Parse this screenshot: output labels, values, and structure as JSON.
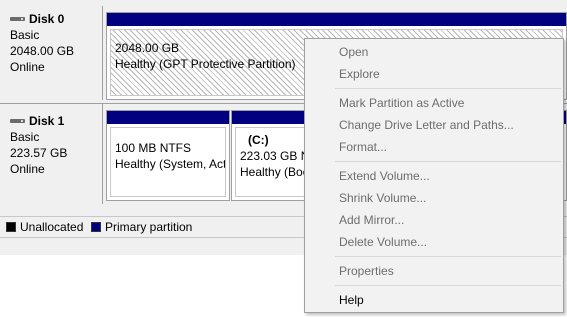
{
  "disks": [
    {
      "name": "Disk 0",
      "type": "Basic",
      "size": "2048.00 GB",
      "status": "Online",
      "partitions": [
        {
          "size": "2048.00 GB",
          "status": "Healthy (GPT Protective Partition)"
        }
      ]
    },
    {
      "name": "Disk 1",
      "type": "Basic",
      "size": "223.57 GB",
      "status": "Online",
      "partitions": [
        {
          "line1": "100 MB NTFS",
          "status": "Healthy (System, Act"
        },
        {
          "drive": "(C:)",
          "line1": "223.03 GB NT",
          "status": "Healthy (Boo"
        }
      ]
    }
  ],
  "legend": {
    "unallocated": "Unallocated",
    "primary": "Primary partition",
    "unallocated_color": "#000000",
    "primary_color": "#000080"
  },
  "context_menu": {
    "open": "Open",
    "explore": "Explore",
    "mark_active": "Mark Partition as Active",
    "change_letter": "Change Drive Letter and Paths...",
    "format": "Format...",
    "extend": "Extend Volume...",
    "shrink": "Shrink Volume...",
    "add_mirror": "Add Mirror...",
    "delete": "Delete Volume...",
    "properties": "Properties",
    "help": "Help"
  }
}
